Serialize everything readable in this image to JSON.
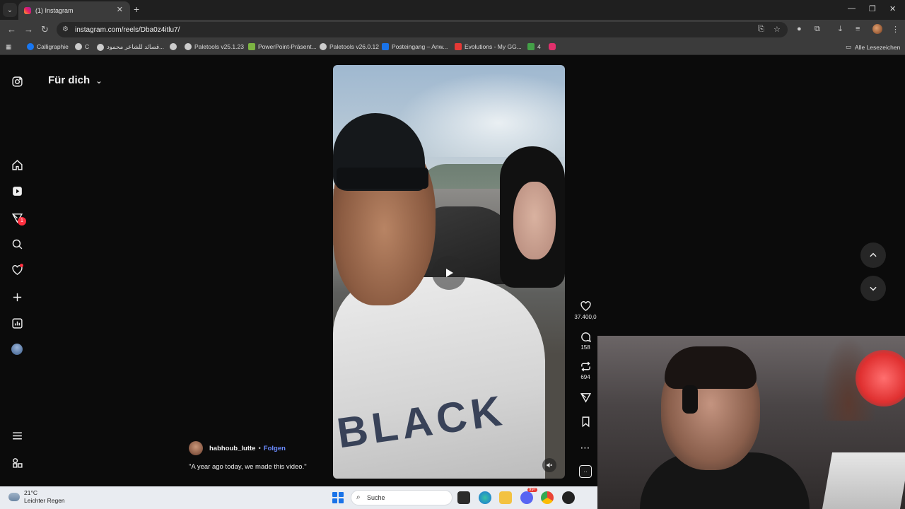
{
  "browser": {
    "tab_title": "(1) Instagram",
    "url": "instagram.com/reels/Dba0z4itlu7/",
    "bookmarks": [
      {
        "label": "Calligraphie",
        "color": "#1877f2"
      },
      {
        "label": "C",
        "color": "#cccccc"
      },
      {
        "label": "قصائد للشاعر محمود...",
        "color": "#cccccc"
      },
      {
        "label": "",
        "color": "#cccccc"
      },
      {
        "label": "Paletools v25.1.23",
        "color": "#cccccc"
      },
      {
        "label": "PowerPoint-Präsent...",
        "color": "#7cb342"
      },
      {
        "label": "Paletools v26.0.12",
        "color": "#cccccc"
      },
      {
        "label": "Posteingang – Anw...",
        "color": "#1a73e8"
      },
      {
        "label": "Evolutions - My GG...",
        "color": "#e53935"
      },
      {
        "label": "4",
        "color": "#43a047"
      },
      {
        "label": "",
        "color": "#e1306c"
      }
    ],
    "all_bookmarks_label": "Alle Lesezeichen"
  },
  "instagram": {
    "feed_title": "Für dich",
    "notification_count": "1",
    "author": "habhoub_lutte",
    "separator": "•",
    "follow_label": "Folgen",
    "caption": "\"A year ago today, we made this video.\"",
    "video_shirt_text": "BLACK",
    "actions": {
      "likes": "37.400,0",
      "comments": "158",
      "reposts": "694"
    }
  },
  "taskbar": {
    "temperature": "21°C",
    "condition": "Leichter Regen",
    "search_label": "Suche",
    "discord_badge": "99+"
  }
}
